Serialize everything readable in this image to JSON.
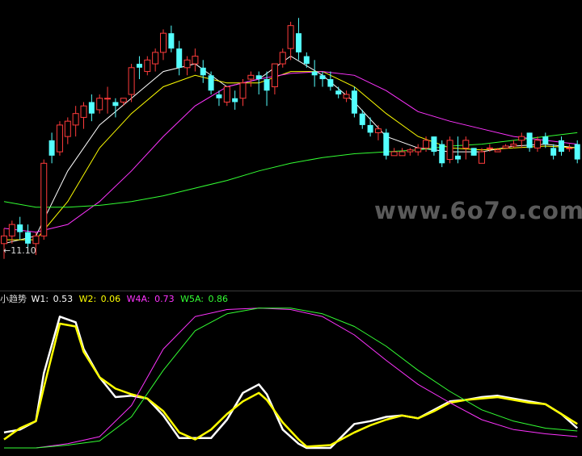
{
  "watermark": "www.6o7o.com",
  "price_panel": {
    "low_marker": "←11.10"
  },
  "indicator_panel": {
    "name": "小趋势",
    "legend": [
      {
        "label": "W1: ",
        "value": "0.53",
        "color": "#ffffff"
      },
      {
        "label": "W2: ",
        "value": "0.06",
        "color": "#ffff00"
      },
      {
        "label": "W4A: ",
        "value": "0.73",
        "color": "#ff33ff"
      },
      {
        "label": "W5A: ",
        "value": "0.86",
        "color": "#33ff33"
      }
    ]
  },
  "colors": {
    "up": "#ff3b3b",
    "down": "#54ffff",
    "ma_white": "#ffffff",
    "ma_yellow": "#ffff00",
    "ma_magenta": "#ff33ff",
    "ma_green": "#33ff33"
  },
  "chart_data": [
    {
      "type": "candlestick",
      "title": "",
      "series": [
        {
          "kind": "candles",
          "ohlc": [
            [
              11.5,
              11.9,
              11.1,
              11.7
            ],
            [
              11.7,
              12.1,
              11.5,
              12.0
            ],
            [
              12.0,
              12.2,
              11.6,
              11.8
            ],
            [
              11.8,
              12.0,
              11.3,
              11.5
            ],
            [
              11.5,
              11.8,
              11.2,
              11.7
            ],
            [
              11.7,
              13.7,
              11.6,
              13.6
            ],
            [
              14.2,
              14.4,
              13.6,
              13.8
            ],
            [
              13.9,
              14.7,
              13.8,
              14.6
            ],
            [
              14.3,
              14.8,
              14.1,
              14.7
            ],
            [
              14.6,
              15.1,
              14.3,
              14.9
            ],
            [
              14.8,
              15.2,
              14.5,
              15.1
            ],
            [
              15.2,
              15.4,
              14.7,
              14.9
            ],
            [
              15.0,
              15.4,
              14.9,
              15.3
            ],
            [
              15.3,
              15.6,
              14.9,
              15.3
            ],
            [
              15.2,
              15.3,
              14.8,
              15.1
            ],
            [
              15.2,
              15.3,
              15.1,
              15.3
            ],
            [
              15.4,
              16.2,
              15.2,
              16.1
            ],
            [
              16.2,
              16.4,
              15.8,
              16.1
            ],
            [
              16.0,
              16.4,
              15.9,
              16.3
            ],
            [
              16.2,
              16.6,
              16.0,
              16.5
            ],
            [
              16.5,
              17.1,
              16.3,
              17.0
            ],
            [
              17.0,
              17.2,
              16.5,
              16.6
            ],
            [
              16.6,
              16.8,
              15.9,
              16.1
            ],
            [
              16.1,
              16.4,
              15.9,
              16.3
            ],
            [
              16.2,
              16.6,
              16.0,
              16.4
            ],
            [
              16.1,
              16.3,
              15.7,
              15.9
            ],
            [
              15.9,
              16.0,
              15.4,
              15.5
            ],
            [
              15.4,
              15.5,
              15.1,
              15.3
            ],
            [
              15.2,
              15.6,
              15.1,
              15.6
            ],
            [
              15.3,
              15.5,
              15.0,
              15.2
            ],
            [
              15.3,
              15.8,
              15.1,
              15.7
            ],
            [
              15.8,
              16.0,
              15.6,
              15.9
            ],
            [
              15.9,
              16.0,
              15.4,
              15.8
            ],
            [
              15.8,
              16.0,
              15.1,
              15.5
            ],
            [
              15.6,
              16.2,
              15.4,
              16.2
            ],
            [
              16.2,
              16.6,
              16.1,
              16.5
            ],
            [
              16.6,
              17.3,
              16.3,
              17.2
            ],
            [
              17.0,
              17.4,
              16.3,
              16.5
            ],
            [
              16.4,
              16.5,
              16.1,
              16.2
            ],
            [
              16.0,
              16.3,
              15.6,
              15.9
            ],
            [
              15.9,
              16.0,
              15.6,
              15.8
            ],
            [
              15.8,
              16.0,
              15.5,
              15.6
            ],
            [
              15.5,
              15.6,
              15.3,
              15.4
            ],
            [
              15.3,
              15.5,
              15.2,
              15.4
            ],
            [
              15.5,
              15.6,
              14.8,
              14.9
            ],
            [
              14.9,
              15.0,
              14.5,
              14.6
            ],
            [
              14.6,
              14.8,
              14.3,
              14.4
            ],
            [
              14.4,
              14.6,
              14.2,
              14.5
            ],
            [
              14.4,
              14.5,
              13.7,
              13.8
            ],
            [
              13.8,
              14.0,
              13.8,
              13.9
            ],
            [
              13.8,
              14.0,
              13.8,
              13.9
            ],
            [
              13.9,
              14.0,
              13.8,
              13.95
            ],
            [
              13.9,
              14.1,
              13.8,
              14.0
            ],
            [
              14.0,
              14.3,
              13.9,
              14.2
            ],
            [
              14.3,
              14.3,
              13.8,
              13.9
            ],
            [
              14.1,
              14.2,
              13.5,
              13.6
            ],
            [
              13.7,
              14.3,
              13.6,
              14.2
            ],
            [
              13.8,
              14.3,
              13.6,
              13.7
            ],
            [
              14.0,
              14.3,
              13.7,
              14.2
            ],
            [
              14.0,
              14.0,
              13.8,
              13.8
            ],
            [
              13.6,
              14.0,
              13.6,
              13.9
            ],
            [
              14.0,
              14.1,
              13.9,
              14.0
            ],
            [
              13.9,
              14.0,
              13.9,
              13.95
            ],
            [
              14.0,
              14.1,
              14.0,
              14.05
            ],
            [
              14.05,
              14.2,
              14.0,
              14.1
            ],
            [
              14.2,
              14.4,
              14.0,
              14.3
            ],
            [
              14.4,
              14.4,
              13.9,
              14.0
            ],
            [
              14.0,
              14.3,
              13.9,
              14.2
            ],
            [
              14.3,
              14.4,
              14.0,
              14.1
            ],
            [
              14.0,
              14.1,
              13.7,
              13.8
            ],
            [
              14.2,
              14.3,
              13.8,
              13.9
            ],
            [
              14.0,
              14.1,
              13.9,
              14.0
            ],
            [
              14.1,
              14.2,
              13.6,
              13.7
            ]
          ]
        },
        {
          "kind": "ma",
          "name": "",
          "color": "#ffffff",
          "x": [
            0,
            4,
            8,
            12,
            16,
            20,
            24,
            28,
            32,
            36,
            40,
            44,
            48,
            52,
            56,
            60,
            64,
            68,
            72
          ],
          "values": [
            11.5,
            11.7,
            13.4,
            14.6,
            15.3,
            16.0,
            16.2,
            15.6,
            15.8,
            16.4,
            15.9,
            15.2,
            14.3,
            14.0,
            13.9,
            13.9,
            14.05,
            14.1,
            14.0
          ]
        },
        {
          "kind": "ma",
          "name": "",
          "color": "#ffff00",
          "x": [
            0,
            4,
            8,
            12,
            16,
            20,
            24,
            28,
            32,
            36,
            40,
            44,
            48,
            52,
            56,
            60,
            64,
            68,
            72
          ],
          "values": [
            11.6,
            11.6,
            12.6,
            14.0,
            14.9,
            15.6,
            15.9,
            15.7,
            15.7,
            16.0,
            16.0,
            15.6,
            14.9,
            14.3,
            14.0,
            13.95,
            14.0,
            14.05,
            14.0
          ]
        },
        {
          "kind": "ma",
          "name": "",
          "color": "#ff33ff",
          "x": [
            0,
            4,
            8,
            12,
            16,
            20,
            24,
            28,
            32,
            36,
            40,
            44,
            48,
            52,
            56,
            60,
            64,
            68,
            72
          ],
          "values": [
            11.9,
            11.8,
            12.0,
            12.6,
            13.4,
            14.3,
            15.1,
            15.6,
            15.8,
            15.95,
            16.0,
            15.9,
            15.5,
            14.95,
            14.7,
            14.5,
            14.3,
            14.2,
            14.1
          ]
        },
        {
          "kind": "ma",
          "name": "",
          "color": "#33ff33",
          "x": [
            0,
            4,
            8,
            12,
            16,
            20,
            24,
            28,
            32,
            36,
            40,
            44,
            48,
            52,
            56,
            60,
            64,
            68,
            72
          ],
          "values": [
            12.6,
            12.45,
            12.45,
            12.5,
            12.6,
            12.75,
            12.95,
            13.15,
            13.4,
            13.6,
            13.75,
            13.85,
            13.9,
            13.95,
            14.05,
            14.1,
            14.2,
            14.3,
            14.4
          ]
        }
      ],
      "x_count": 73,
      "ylim": [
        10.8,
        17.7
      ],
      "grid": false
    },
    {
      "type": "line",
      "title": "小趋势",
      "ylim": [
        0,
        1
      ],
      "grid": false,
      "series": [
        {
          "name": "W1",
          "color": "#ffffff",
          "x": [
            0,
            2,
            4,
            5,
            7,
            9,
            10,
            12,
            14,
            16,
            18,
            20,
            22,
            24,
            26,
            28,
            30,
            32,
            33,
            35,
            37,
            38,
            41,
            44,
            46,
            48,
            50,
            52,
            54,
            56,
            58,
            60,
            62,
            64,
            66,
            68,
            70,
            72
          ],
          "values": [
            0.11,
            0.13,
            0.19,
            0.53,
            0.93,
            0.89,
            0.7,
            0.5,
            0.36,
            0.37,
            0.35,
            0.23,
            0.07,
            0.07,
            0.07,
            0.2,
            0.39,
            0.45,
            0.38,
            0.13,
            0.03,
            0.0,
            0.0,
            0.17,
            0.19,
            0.22,
            0.23,
            0.21,
            0.27,
            0.33,
            0.34,
            0.36,
            0.37,
            0.35,
            0.33,
            0.31,
            0.24,
            0.14
          ]
        },
        {
          "name": "W2",
          "color": "#ffff00",
          "x": [
            0,
            2,
            4,
            5,
            7,
            9,
            10,
            12,
            14,
            16,
            18,
            20,
            22,
            24,
            26,
            28,
            30,
            32,
            33,
            35,
            37,
            38,
            41,
            44,
            46,
            48,
            50,
            52,
            54,
            56,
            58,
            60,
            62,
            64,
            66,
            68,
            70,
            72
          ],
          "values": [
            0.06,
            0.14,
            0.19,
            0.43,
            0.88,
            0.86,
            0.68,
            0.5,
            0.42,
            0.38,
            0.35,
            0.26,
            0.11,
            0.06,
            0.13,
            0.24,
            0.33,
            0.39,
            0.34,
            0.18,
            0.06,
            0.01,
            0.02,
            0.11,
            0.16,
            0.2,
            0.23,
            0.21,
            0.26,
            0.32,
            0.34,
            0.35,
            0.36,
            0.34,
            0.32,
            0.31,
            0.24,
            0.17
          ]
        },
        {
          "name": "W4A",
          "color": "#ff33ff",
          "x": [
            0,
            4,
            8,
            12,
            16,
            20,
            24,
            28,
            32,
            36,
            40,
            44,
            48,
            52,
            56,
            60,
            64,
            68,
            72
          ],
          "values": [
            0.0,
            0.0,
            0.03,
            0.08,
            0.3,
            0.7,
            0.93,
            0.98,
            0.99,
            0.98,
            0.93,
            0.8,
            0.62,
            0.45,
            0.32,
            0.2,
            0.13,
            0.1,
            0.08
          ]
        },
        {
          "name": "W5A",
          "color": "#33ff33",
          "x": [
            0,
            4,
            8,
            12,
            16,
            20,
            24,
            28,
            32,
            36,
            40,
            44,
            48,
            52,
            56,
            60,
            64,
            68,
            72
          ],
          "values": [
            0.0,
            0.0,
            0.02,
            0.05,
            0.22,
            0.55,
            0.83,
            0.95,
            0.99,
            0.99,
            0.95,
            0.86,
            0.72,
            0.55,
            0.4,
            0.27,
            0.19,
            0.14,
            0.12
          ]
        }
      ]
    }
  ]
}
